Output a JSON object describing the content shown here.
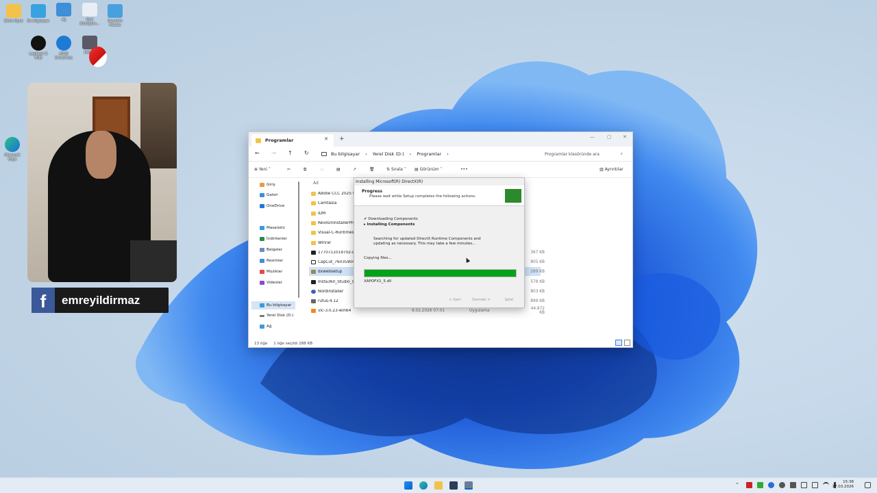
{
  "desktop": {
    "icons": [
      {
        "label": "Emre Oyun"
      },
      {
        "label": "Bu bilgisayar"
      },
      {
        "label": "Ağ"
      },
      {
        "label": "Geri Dönüşüm..."
      },
      {
        "label": "Denetim Masası"
      },
      {
        "label": "Logitech G HUB"
      },
      {
        "label": "ASUS DriverHub"
      },
      {
        "label": "EKB UI"
      },
      {
        "label": "Microsoft Edge"
      }
    ]
  },
  "webcam": {
    "social": {
      "name": "emreyildirmaz",
      "logo": "f"
    }
  },
  "explorer": {
    "tab_title": "Programlar",
    "breadcrumbs": [
      "Bu bilgisayar",
      "›",
      "Yerel Disk (D:)",
      "›",
      "Programlar",
      "›"
    ],
    "search_placeholder": "Programlar klasöründe ara",
    "toolbar": {
      "new": "Yeni",
      "sort": "Sırala",
      "view": "Görünüm",
      "more": "•••",
      "details": "Ayrıntılar"
    },
    "sidebar": [
      {
        "label": "Giriş"
      },
      {
        "label": "Galeri"
      },
      {
        "label": "OneDrive"
      },
      {
        "label": "Masaüstü"
      },
      {
        "label": "İndirilenler"
      },
      {
        "label": "Belgeler"
      },
      {
        "label": "Resimler"
      },
      {
        "label": "Müzikler"
      },
      {
        "label": "Videolar"
      },
      {
        "label": "Bu bilgisayar"
      },
      {
        "label": "Yerel Disk (D:)"
      },
      {
        "label": "Ağ"
      }
    ],
    "column_name": "Ad",
    "files": [
      {
        "name": "Adobe CCC 2025 v17",
        "date": "",
        "type": "",
        "size": ""
      },
      {
        "name": "Camtasia",
        "date": "",
        "type": "",
        "size": ""
      },
      {
        "name": "IDM",
        "date": "",
        "type": "",
        "size": ""
      },
      {
        "name": "RevoUninstallerPro5",
        "date": "",
        "type": "",
        "size": ""
      },
      {
        "name": "Visual-C-Runtimes-Al",
        "date": "",
        "type": "",
        "size": ""
      },
      {
        "name": "Winrar",
        "date": "",
        "type": "",
        "size": ""
      },
      {
        "name": "1770711019702-DX5",
        "date": "",
        "type": "",
        "size": "367 KB"
      },
      {
        "name": "CapCut_760359042!",
        "date": "",
        "type": "",
        "size": "805 KB"
      },
      {
        "name": "dxwebsetup",
        "date": "",
        "type": "",
        "size": "289 KB"
      },
      {
        "name": "Insta360_Studio_5.9.2",
        "date": "",
        "type": "",
        "size": "578 KB"
      },
      {
        "name": "NordInstaller",
        "date": "",
        "type": "",
        "size": "803 KB"
      },
      {
        "name": "rufus-4.12",
        "date": "",
        "type": "",
        "size": "899 KB"
      },
      {
        "name": "vlc-3.0.23-win64",
        "date": "8.02.2026 07:01",
        "type": "Uygulama",
        "size": "44.872 KB"
      }
    ],
    "status": {
      "count": "13 öğe",
      "selected": "1 öğe seçildi  288 KB"
    }
  },
  "dialog": {
    "title": "Installing Microsoft(R) DirectX(R)",
    "heading": "Progress",
    "subheading": "Please wait while Setup completes the following actions.",
    "step1": "✔ Downloading Components",
    "step2": "▸ Installing Components",
    "info": "Searching for updated DirectX Runtime Components and updating as necessary. This may take a few minutes...",
    "copying": "Copying files...",
    "progress": 1.0,
    "current_file": "XAPOFX1_5.dll",
    "buttons": {
      "back": "< Geri",
      "next": "Sonraki >",
      "cancel": "İptal"
    }
  },
  "taskbar": {
    "clock_time": "15:38",
    "clock_date": "17.03.2026"
  },
  "colors": {
    "progress": "#06a11a",
    "accent": "#0a64c8"
  }
}
